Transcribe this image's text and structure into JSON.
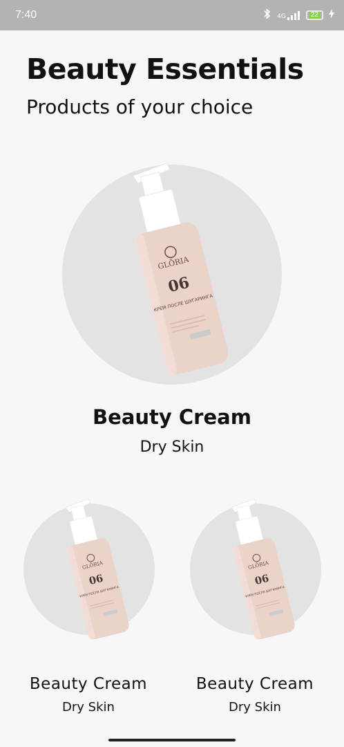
{
  "status": {
    "time": "7:40",
    "network": "4G",
    "battery": "22",
    "icons": [
      "bluetooth-icon",
      "signal-icon",
      "battery-icon",
      "charging-icon"
    ]
  },
  "header": {
    "title": "Beauty Essentials",
    "subtitle": "Products of your choice"
  },
  "featured": {
    "name": "Beauty Cream",
    "type": "Dry Skin",
    "brand": "GLŌRIA",
    "number": "06",
    "label": "КРЕМ ПОСЛЕ ШУГАРИНГА"
  },
  "products": [
    {
      "name": "Beauty Cream",
      "type": "Dry Skin"
    },
    {
      "name": "Beauty Cream",
      "type": "Dry Skin"
    }
  ],
  "colors": {
    "status_bar": "#b3b3b3",
    "background": "#f7f7f7",
    "circle": "#e3e3e3",
    "bottle": "#ecd3c9",
    "battery_fill": "#8bd04e"
  }
}
